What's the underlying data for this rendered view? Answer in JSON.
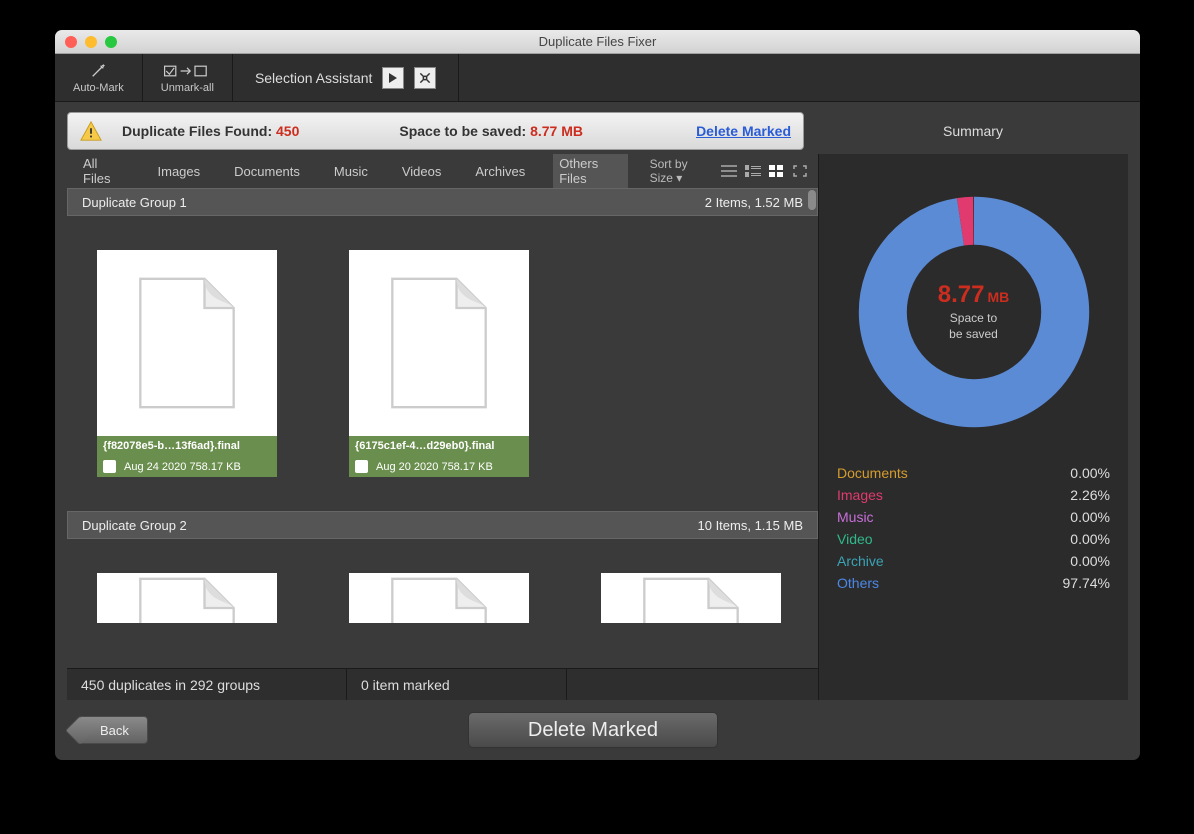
{
  "title": "Duplicate Files Fixer",
  "toolbar": {
    "automark": "Auto-Mark",
    "unmarkall": "Unmark-all",
    "selection_assistant": "Selection Assistant"
  },
  "info": {
    "dup_label": "Duplicate Files Found:",
    "dup_count": "450",
    "space_label": "Space to be saved:",
    "space_value": "8.77 MB",
    "delete_link": "Delete Marked"
  },
  "summary_title": "Summary",
  "tabs": [
    "All Files",
    "Images",
    "Documents",
    "Music",
    "Videos",
    "Archives",
    "Others Files"
  ],
  "sort_label": "Sort by Size",
  "groups": [
    {
      "name": "Duplicate Group 1",
      "meta": "2 Items, 1.52 MB",
      "items": [
        {
          "name": "{f82078e5-b…13f6ad}.final",
          "sub": "Aug 24 2020 758.17 KB"
        },
        {
          "name": "{6175c1ef-4…d29eb0}.final",
          "sub": "Aug 20 2020 758.17 KB"
        }
      ]
    },
    {
      "name": "Duplicate Group 2",
      "meta": "10 Items, 1.15 MB"
    }
  ],
  "donut": {
    "value": "8.77",
    "unit": "MB",
    "label": "Space to\nbe saved"
  },
  "legend": [
    {
      "label": "Documents",
      "pct": "0.00%",
      "cls": "c-doc"
    },
    {
      "label": "Images",
      "pct": "2.26%",
      "cls": "c-img"
    },
    {
      "label": "Music",
      "pct": "0.00%",
      "cls": "c-mus"
    },
    {
      "label": "Video",
      "pct": "0.00%",
      "cls": "c-vid"
    },
    {
      "label": "Archive",
      "pct": "0.00%",
      "cls": "c-arc"
    },
    {
      "label": "Others",
      "pct": "97.74%",
      "cls": "c-oth"
    }
  ],
  "status": {
    "dup": "450 duplicates in 292 groups",
    "marked": "0 item marked"
  },
  "back": "Back",
  "delete_big": "Delete Marked",
  "chart_data": {
    "type": "pie",
    "title": "Space to be saved 8.77 MB",
    "series": [
      {
        "name": "Documents",
        "value": 0.0
      },
      {
        "name": "Images",
        "value": 2.26
      },
      {
        "name": "Music",
        "value": 0.0
      },
      {
        "name": "Video",
        "value": 0.0
      },
      {
        "name": "Archive",
        "value": 0.0
      },
      {
        "name": "Others",
        "value": 97.74
      }
    ]
  }
}
